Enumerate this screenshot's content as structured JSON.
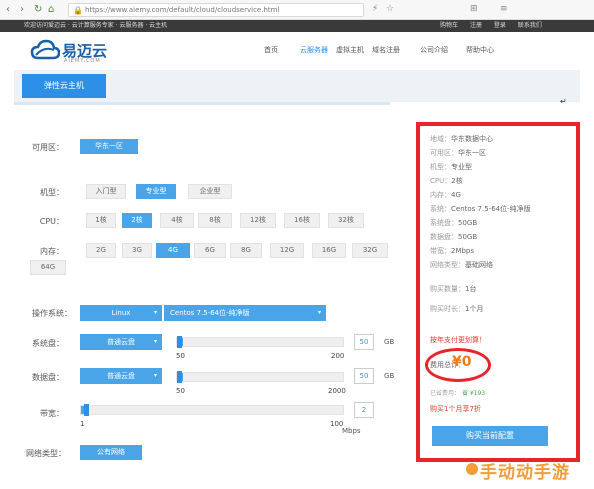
{
  "browser": {
    "url": "https://www.aiemy.com/default/cloud/cloudservice.html",
    "nav": {
      "back": "‹",
      "forward": "›",
      "reload": "↻",
      "home": "⌂"
    }
  },
  "site": {
    "greeting": "欢迎访问爱迈云 · 云计算服务专家 · 云服务器 · 云主机",
    "top_links": [
      "购物车",
      "注册",
      "登录",
      "联系我们"
    ],
    "logo_text": "易迈云",
    "logo_sub": "AIEMY.COM",
    "menu": [
      "首页",
      "云服务器",
      "虚拟主机",
      "域名注册",
      "公司介绍",
      "帮助中心"
    ],
    "active_menu": "云服务器"
  },
  "tab": {
    "label": "弹性云主机"
  },
  "form": {
    "zone": {
      "label": "可用区：",
      "options": [
        "华东一区"
      ],
      "selected": "华东一区"
    },
    "model": {
      "label": "机型：",
      "options": [
        "入门型",
        "专业型",
        "企业型"
      ],
      "selected": "专业型"
    },
    "cpu": {
      "label": "CPU：",
      "options": [
        "1核",
        "2核",
        "4核",
        "8核",
        "12核",
        "16核",
        "32核"
      ],
      "selected": "2核"
    },
    "memory": {
      "label": "内存：",
      "options": [
        "2G",
        "3G",
        "4G",
        "6G",
        "8G",
        "12G",
        "16G",
        "32G",
        "64G"
      ],
      "selected": "4G"
    },
    "os": {
      "label": "操作系统：",
      "type": "Linux",
      "version": "Centos 7.5-64位-纯净版"
    },
    "system_disk": {
      "label": "系统盘：",
      "type": "普通云盘",
      "value": "50",
      "unit": "GB",
      "min": "50",
      "max": "200",
      "level": 0
    },
    "data_disk": {
      "label": "数据盘：",
      "type": "普通云盘",
      "value": "50",
      "unit": "GB",
      "min": "50",
      "max": "2000",
      "level": 0
    },
    "bandwidth": {
      "label": "带宽：",
      "value": "2",
      "unit": "Mbps",
      "min": "1",
      "max": "100",
      "level": 0.01
    },
    "network": {
      "label": "网络类型：",
      "value": "公有网络"
    }
  },
  "summary": {
    "rows": [
      {
        "k": "地域：",
        "v": "华东数据中心"
      },
      {
        "k": "可用区：",
        "v": "华东一区"
      },
      {
        "k": "机型：",
        "v": "专业型"
      },
      {
        "k": "CPU：",
        "v": "2核"
      },
      {
        "k": "内存：",
        "v": "4G"
      },
      {
        "k": "系统：",
        "v": "Centos 7.5-64位-纯净版"
      },
      {
        "k": "系统盘：",
        "v": "50GB"
      },
      {
        "k": "数据盘：",
        "v": "50GB"
      },
      {
        "k": "带宽：",
        "v": "2Mbps"
      },
      {
        "k": "网络类型：",
        "v": "基础网络"
      },
      {
        "k": "购买数量：",
        "v": "1台"
      },
      {
        "k": "购买时长：",
        "v": "1个月"
      }
    ],
    "promo": "按年支付更划算！",
    "fee_label": "费用总计：",
    "price": "¥0",
    "save_text": "已省费用：",
    "save_value": "省 ¥193",
    "discount": "购买1个月享7折",
    "buy_button": "购买当前配置"
  },
  "watermark": "手动动手游",
  "colors": {
    "accent": "#2e8fe6",
    "selected": "#4aa5e8",
    "highlight": "#e8252a",
    "price": "#f07a1a"
  }
}
